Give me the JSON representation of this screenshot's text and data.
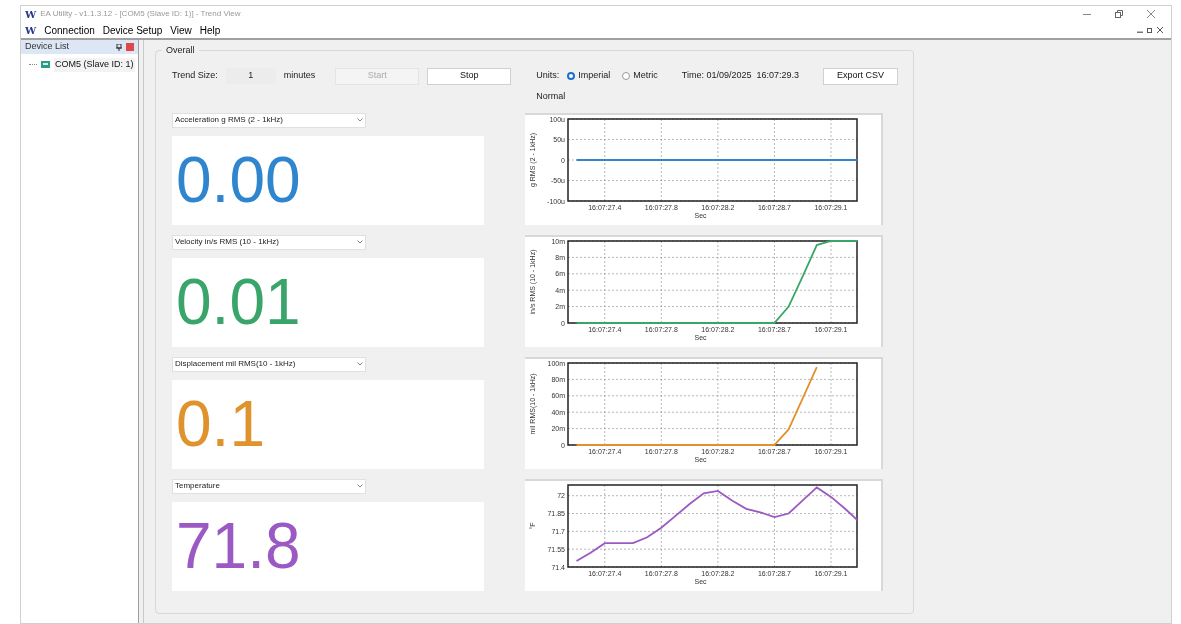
{
  "window": {
    "title": "EA Utility - v1.1.3.12 - [COM5 (Slave ID: 1)] - Trend View",
    "logo": "W"
  },
  "menu_logo": "W",
  "menu": [
    "Connection",
    "Device Setup",
    "View",
    "Help"
  ],
  "sidebar": {
    "title": "Device List",
    "items": [
      {
        "label": "COM5 (Slave ID: 1)",
        "selected": true
      }
    ]
  },
  "group_title": "Overall",
  "toolbar": {
    "trend_size_label": "Trend Size:",
    "trend_size_value": "1",
    "trend_size_unit": "minutes",
    "start": {
      "label": "Start",
      "disabled": true
    },
    "stop": {
      "label": "Stop",
      "disabled": false
    },
    "units_label": "Units:",
    "units": [
      {
        "label": "Imperial",
        "selected": true
      },
      {
        "label": "Metric",
        "selected": false
      }
    ],
    "time": "Time: 01/09/2025  16:07:29.3",
    "export": "Export CSV",
    "status": "Normal"
  },
  "panels": [
    {
      "measure": "Acceleration g RMS (2 - 1kHz)",
      "value": "0.00",
      "color": "#2f86cf",
      "chart_data": {
        "type": "line",
        "xlabel": "Sec",
        "ylabel": "g RMS (2 - 1kHz)",
        "grid": true,
        "ylim": [
          -100,
          100
        ],
        "yticks": [
          {
            "value": 100,
            "label": "100u"
          },
          {
            "value": 50,
            "label": "50u"
          },
          {
            "value": 0,
            "label": "0"
          },
          {
            "value": -50,
            "label": "-50u"
          },
          {
            "value": -100,
            "label": "-100u"
          }
        ],
        "categories": [
          null,
          null,
          "16:07:27.4",
          null,
          null,
          null,
          "16:07:27.8",
          null,
          null,
          null,
          "16:07:28.2",
          null,
          null,
          null,
          "16:07:28.7",
          null,
          null,
          null,
          "16:07:29.1",
          null,
          null
        ],
        "series": [
          {
            "color": "#2f86cf",
            "values": [
              0,
              0,
              0,
              0,
              0,
              0,
              0,
              0,
              0,
              0,
              0,
              0,
              0,
              0,
              0,
              0,
              0,
              0,
              0,
              0,
              0
            ]
          }
        ]
      }
    },
    {
      "measure": "Velocity in/s RMS (10 - 1kHz)",
      "value": "0.01",
      "color": "#3aa56a",
      "chart_data": {
        "type": "line",
        "xlabel": "Sec",
        "ylabel": "in/s RMS (10 - 1kHz)",
        "grid": true,
        "ylim": [
          0,
          10
        ],
        "yticks": [
          {
            "value": 10,
            "label": "10m"
          },
          {
            "value": 8,
            "label": "8m"
          },
          {
            "value": 6,
            "label": "6m"
          },
          {
            "value": 4,
            "label": "4m"
          },
          {
            "value": 2,
            "label": "2m"
          },
          {
            "value": 0,
            "label": "0"
          }
        ],
        "categories": [
          null,
          null,
          "16:07:27.4",
          null,
          null,
          null,
          "16:07:27.8",
          null,
          null,
          null,
          "16:07:28.2",
          null,
          null,
          null,
          "16:07:28.7",
          null,
          null,
          null,
          "16:07:29.1",
          null,
          null
        ],
        "series": [
          {
            "color": "#3aa56a",
            "values": [
              0,
              0,
              0,
              0,
              0,
              0,
              0,
              0,
              0,
              0,
              0,
              0,
              0,
              0,
              0,
              2,
              5.7,
              9.5,
              10,
              10,
              10
            ]
          }
        ]
      }
    },
    {
      "measure": "Displacement mil RMS(10 - 1kHz)",
      "value": "0.1",
      "color": "#e0922c",
      "chart_data": {
        "type": "line",
        "xlabel": "Sec",
        "ylabel": "mil RMS(10 - 1kHz)",
        "grid": true,
        "ylim": [
          0,
          100
        ],
        "yticks": [
          {
            "value": 100,
            "label": "100m"
          },
          {
            "value": 80,
            "label": "80m"
          },
          {
            "value": 60,
            "label": "60m"
          },
          {
            "value": 40,
            "label": "40m"
          },
          {
            "value": 20,
            "label": "20m"
          },
          {
            "value": 0,
            "label": "0"
          }
        ],
        "categories": [
          null,
          null,
          "16:07:27.4",
          null,
          null,
          null,
          "16:07:27.8",
          null,
          null,
          null,
          "16:07:28.2",
          null,
          null,
          null,
          "16:07:28.7",
          null,
          null,
          null,
          "16:07:29.1",
          null,
          null
        ],
        "series": [
          {
            "color": "#e0922c",
            "values": [
              0,
              0,
              0,
              0,
              0,
              0,
              0,
              0,
              0,
              0,
              0,
              0,
              0,
              0,
              0,
              19,
              57,
              95,
              null,
              null,
              null
            ]
          }
        ]
      }
    },
    {
      "measure": "Temperature",
      "value": "71.8",
      "color": "#9b59c4",
      "chart_data": {
        "type": "line",
        "xlabel": "Sec",
        "ylabel": "°F",
        "grid": true,
        "ylim": [
          71.4,
          72.09
        ],
        "yticks": [
          {
            "value": 72,
            "label": "72"
          },
          {
            "value": 71.85,
            "label": "71.85"
          },
          {
            "value": 71.7,
            "label": "71.7"
          },
          {
            "value": 71.55,
            "label": "71.55"
          },
          {
            "value": 71.4,
            "label": "71.4"
          }
        ],
        "categories": [
          null,
          null,
          "16:07:27.4",
          null,
          null,
          null,
          "16:07:27.8",
          null,
          null,
          null,
          "16:07:28.2",
          null,
          null,
          null,
          "16:07:28.7",
          null,
          null,
          null,
          "16:07:29.1",
          null,
          null
        ],
        "series": [
          {
            "color": "#9b59c4",
            "values": [
              71.45,
              71.52,
              71.6,
              71.6,
              71.6,
              71.65,
              71.73,
              71.83,
              71.93,
              72.02,
              72.04,
              71.96,
              71.89,
              71.86,
              71.82,
              71.85,
              71.96,
              72.07,
              71.99,
              71.89,
              71.78
            ]
          }
        ]
      }
    }
  ]
}
